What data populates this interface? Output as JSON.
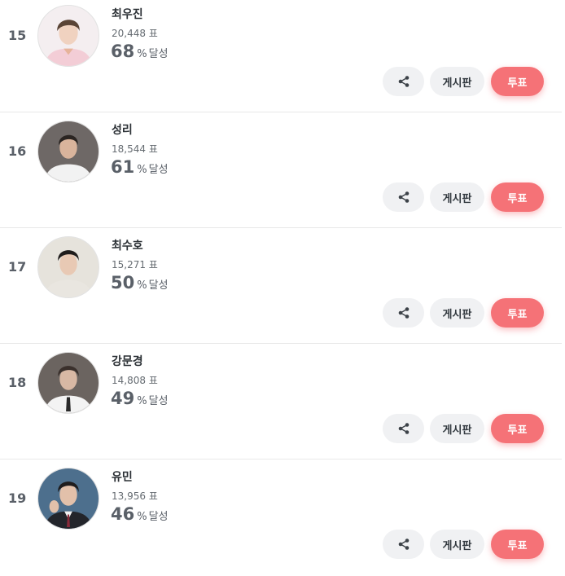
{
  "list": {
    "rows": [
      {
        "rank": "15",
        "name": "최우진",
        "votes": "20,448 표",
        "percent": "68",
        "percent_sign": "%",
        "achieved_label": "달성",
        "share_icon": "share-icon",
        "board_label": "게시판",
        "vote_label": "투표"
      },
      {
        "rank": "16",
        "name": "성리",
        "votes": "18,544 표",
        "percent": "61",
        "percent_sign": "%",
        "achieved_label": "달성",
        "share_icon": "share-icon",
        "board_label": "게시판",
        "vote_label": "투표"
      },
      {
        "rank": "17",
        "name": "최수호",
        "votes": "15,271 표",
        "percent": "50",
        "percent_sign": "%",
        "achieved_label": "달성",
        "share_icon": "share-icon",
        "board_label": "게시판",
        "vote_label": "투표"
      },
      {
        "rank": "18",
        "name": "강문경",
        "votes": "14,808 표",
        "percent": "49",
        "percent_sign": "%",
        "achieved_label": "달성",
        "share_icon": "share-icon",
        "board_label": "게시판",
        "vote_label": "투표"
      },
      {
        "rank": "19",
        "name": "유민",
        "votes": "13,956 표",
        "percent": "46",
        "percent_sign": "%",
        "achieved_label": "달성",
        "share_icon": "share-icon",
        "board_label": "게시판",
        "vote_label": "투표"
      }
    ]
  },
  "colors": {
    "vote_button": "#f57277",
    "secondary_button": "#f0f1f3",
    "text_primary": "#2b3035",
    "text_muted": "#5a6068"
  }
}
